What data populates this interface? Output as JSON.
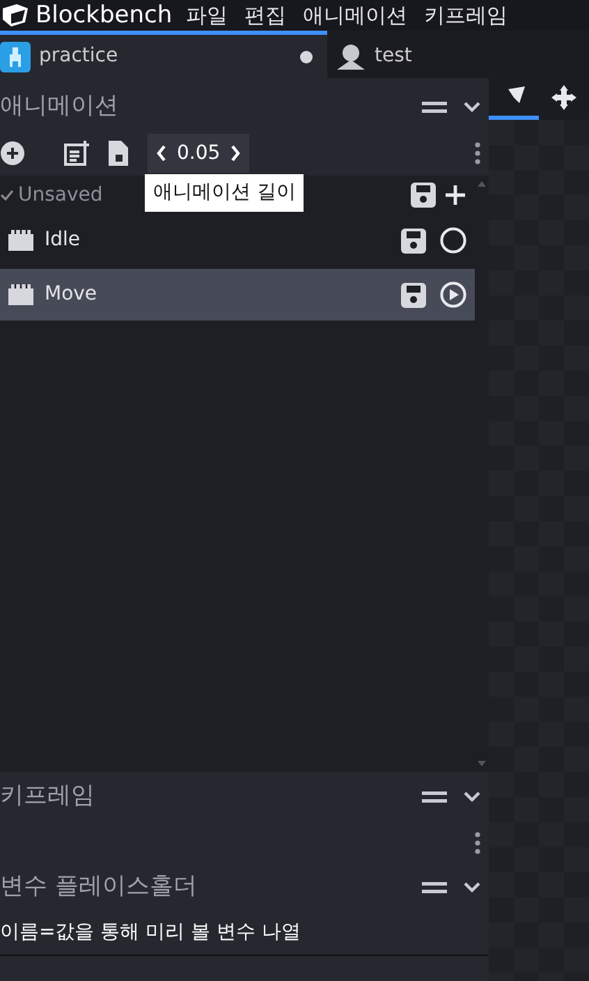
{
  "title_bar": {
    "app_name": "Blockbench",
    "menu": [
      "파일",
      "편집",
      "애니메이션",
      "키프레임"
    ]
  },
  "tabs": [
    {
      "label": "practice",
      "selected": true,
      "unsaved": true
    },
    {
      "label": "test",
      "selected": false,
      "unsaved": false
    }
  ],
  "animations_panel": {
    "title": "애니메이션",
    "length_value": "0.05",
    "tooltip": "애니메이션 길이",
    "groups": [
      {
        "label": "Unsaved",
        "expanded": true,
        "items": [
          {
            "name": "Idle",
            "selected": false,
            "playing": false
          },
          {
            "name": "Move",
            "selected": true,
            "playing": true
          }
        ]
      }
    ]
  },
  "keyframe_panel": {
    "title": "키프레임"
  },
  "variable_panel": {
    "title": "변수 플레이스홀더",
    "text": "이름=값을 통해 미리 볼 변수 나열"
  },
  "viewport_tools": [
    {
      "selected": true
    },
    {
      "selected": false
    }
  ]
}
